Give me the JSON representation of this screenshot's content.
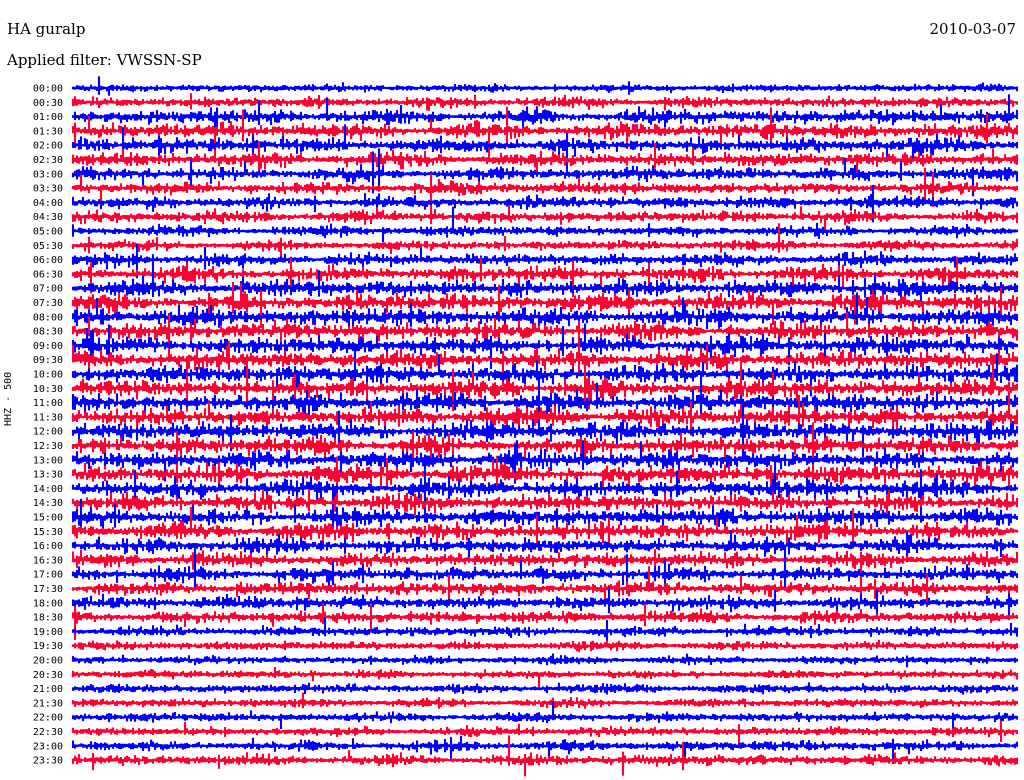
{
  "header": {
    "title": "HA guralp",
    "filter_label": "Applied filter: VWSSN-SP",
    "date": "2010-03-07"
  },
  "chart_data": {
    "type": "line",
    "title": "HA guralp",
    "subtitle": "Applied filter: VWSSN-SP",
    "date": "2010-03-07",
    "ylabel": "HHZ - 500",
    "row_labels": [
      "00:00",
      "00:30",
      "01:00",
      "01:30",
      "02:00",
      "02:30",
      "03:00",
      "03:30",
      "04:00",
      "04:30",
      "05:00",
      "05:30",
      "06:00",
      "06:30",
      "07:00",
      "07:30",
      "08:00",
      "08:30",
      "09:00",
      "09:30",
      "10:00",
      "10:30",
      "11:00",
      "11:30",
      "12:00",
      "12:30",
      "13:00",
      "13:30",
      "14:00",
      "14:30",
      "15:00",
      "15:30",
      "16:00",
      "16:30",
      "17:00",
      "17:30",
      "18:00",
      "18:30",
      "19:00",
      "19:30",
      "20:00",
      "20:30",
      "21:00",
      "21:30",
      "22:00",
      "22:30",
      "23:00",
      "23:30"
    ],
    "row_colors": [
      "#0000ff",
      "#ff0033"
    ],
    "row_amplitude_level": [
      0.22,
      0.4,
      0.7,
      0.8,
      0.75,
      0.7,
      0.65,
      0.55,
      0.55,
      0.5,
      0.4,
      0.35,
      0.6,
      0.7,
      0.85,
      0.95,
      1.0,
      1.0,
      1.0,
      1.0,
      1.0,
      1.0,
      1.0,
      1.0,
      1.0,
      1.0,
      1.0,
      1.0,
      0.95,
      0.9,
      0.85,
      0.8,
      0.75,
      0.7,
      0.7,
      0.65,
      0.6,
      0.55,
      0.35,
      0.3,
      0.22,
      0.25,
      0.3,
      0.28,
      0.3,
      0.3,
      0.4,
      0.45
    ]
  }
}
